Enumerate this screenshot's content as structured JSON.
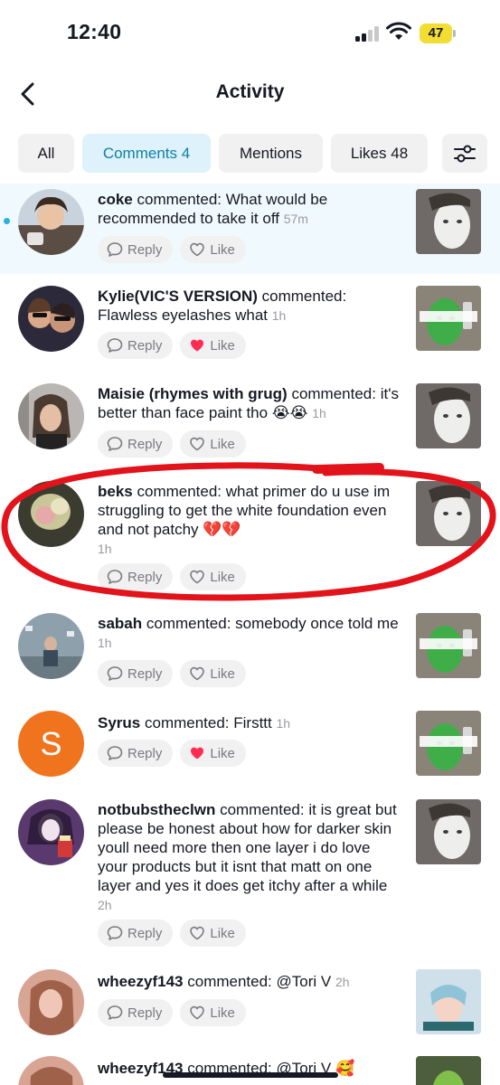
{
  "status": {
    "time": "12:40",
    "battery": "47"
  },
  "nav": {
    "title": "Activity"
  },
  "tabs": [
    {
      "label": "All"
    },
    {
      "label": "Comments 4"
    },
    {
      "label": "Mentions"
    },
    {
      "label": "Likes 48"
    }
  ],
  "actions": {
    "reply": "Reply",
    "like": "Like"
  },
  "notifications": [
    {
      "user": "coke",
      "verb": "commented:",
      "comment": "What would be recommended to take it off",
      "time": "57m",
      "liked": false,
      "unread": true
    },
    {
      "user": "Kylie(VIC'S VERSION)",
      "verb": "commented:",
      "comment": "Flawless eyelashes what",
      "time": "1h",
      "liked": true,
      "unread": false
    },
    {
      "user": "Maisie (rhymes with grug)",
      "verb": "commented:",
      "comment": "it's better than face paint tho 😭😭",
      "time": "1h",
      "liked": false,
      "unread": false
    },
    {
      "user": "beks",
      "verb": "commented:",
      "comment": "what primer do u use im struggling to get the white foundation even and not patchy 💔💔",
      "time": "1h",
      "liked": false,
      "unread": false
    },
    {
      "user": "sabah",
      "verb": "commented:",
      "comment": "somebody once told me",
      "time": "1h",
      "liked": false,
      "unread": false
    },
    {
      "user": "Syrus",
      "verb": "commented:",
      "comment": "Firsttt",
      "time": "1h",
      "liked": true,
      "unread": false,
      "avatar_letter": "S"
    },
    {
      "user": "notbubstheclwn",
      "verb": "commented:",
      "comment": "it is great but please be honest about how for darker skin youll need more then one layer i do love your products but it isnt that matt on one layer and yes it does get itchy after a while",
      "time": "2h",
      "liked": false,
      "unread": false
    },
    {
      "user": "wheezyf143",
      "verb": "commented:",
      "comment": "@Tori V",
      "time": "2h",
      "liked": false,
      "unread": false
    },
    {
      "user": "wheezyf143",
      "verb": "commented:",
      "comment": "@Tori V 🥰",
      "time": "",
      "liked": false,
      "unread": false
    }
  ],
  "colors": {
    "accent": "#0f7fa8",
    "like_active": "#fe2c55",
    "annotation": "#e3131b"
  }
}
